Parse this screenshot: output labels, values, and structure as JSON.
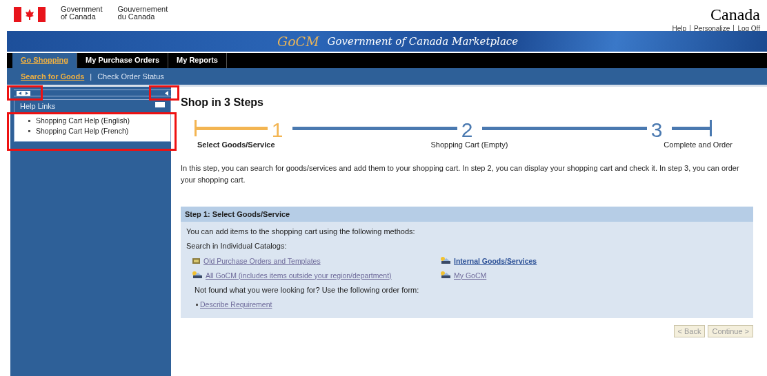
{
  "header": {
    "gov_en": [
      "Government",
      "of Canada"
    ],
    "gov_fr": [
      "Gouvernement",
      "du Canada"
    ],
    "wordmark": "Canada",
    "utility_links": [
      "Help",
      "Personalize",
      "Log Off"
    ]
  },
  "banner": {
    "logo": "GoCM",
    "title": "Government of Canada Marketplace"
  },
  "tabs": [
    {
      "label": "Go Shopping",
      "selected": true
    },
    {
      "label": "My Purchase Orders",
      "selected": false
    },
    {
      "label": "My Reports",
      "selected": false
    }
  ],
  "subnav": [
    {
      "label": "Search for Goods",
      "selected": true
    },
    {
      "label": "Check Order Status",
      "selected": false
    }
  ],
  "subnav_separator": "|",
  "sidebar": {
    "panel_title": "Help Links",
    "links": [
      "Shopping Cart Help (English)",
      "Shopping Cart Help (French)"
    ]
  },
  "annotations": [
    {
      "kind": "toggle"
    },
    {
      "kind": "collapse"
    },
    {
      "kind": "panel"
    }
  ],
  "page_title": "Shop in 3 Steps",
  "steps": [
    {
      "number": "1",
      "label": "Select Goods/Service",
      "selected": true
    },
    {
      "number": "2",
      "label": "Shopping Cart (Empty)",
      "selected": false
    },
    {
      "number": "3",
      "label": "Complete and Order",
      "selected": false
    }
  ],
  "intro": "In this step, you can search for goods/services and add them to your shopping cart. In step 2, you can display your shopping cart and check it. In step 3, you can order your shopping cart.",
  "section": {
    "title": "Step 1: Select Goods/Service",
    "description": "You can add items to the shopping cart using the following methods:",
    "catalogs_heading": "Search in Individual Catalogs:",
    "catalogs": [
      {
        "label": "Old Purchase Orders and Templates",
        "kind": "templates",
        "visited": true
      },
      {
        "label": "Internal Goods/Services",
        "kind": "catalog",
        "visited": false
      },
      {
        "label": "All GoCM (includes items outside your region/department)",
        "kind": "catalog",
        "visited": true
      },
      {
        "label": "My GoCM",
        "kind": "catalog",
        "visited": true
      }
    ],
    "order_form_prompt": "Not found what you were looking for? Use the following order form:",
    "order_form_link": "Describe Requirement"
  },
  "buttons": [
    {
      "label": "< Back",
      "disabled": true
    },
    {
      "label": "Continue >",
      "disabled": true
    }
  ]
}
